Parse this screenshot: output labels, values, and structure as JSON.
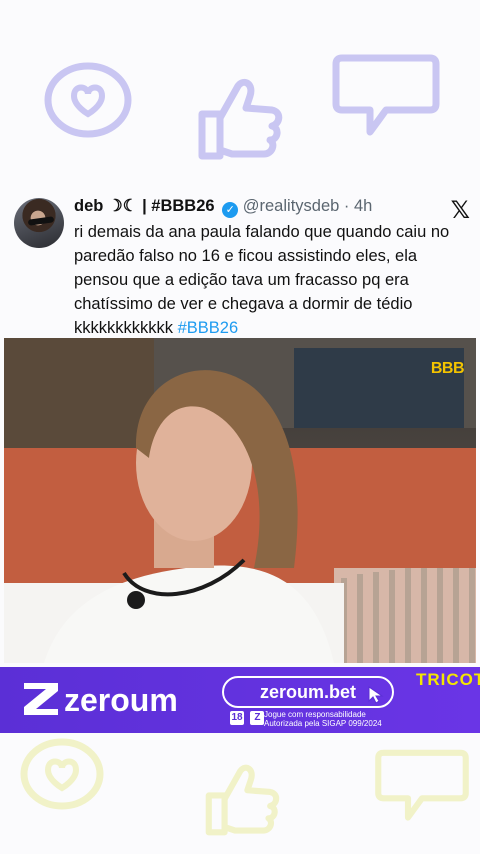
{
  "tweet": {
    "display_name": "deb ☽☾ | #BBB26",
    "verified_icon": "verified-badge-icon",
    "handle": "@realitysdeb",
    "time": "· 4h",
    "platform_icon": "x-logo-icon",
    "text_part1": "ri demais da ana paula falando que quando caiu no paredão falso no 16 e ficou assistindo eles, ela pensou que a edição tava um fracasso pq era chatíssimo de ver e chegava a dormir de tédio kkkkkkkkkkkk ",
    "hashtag": "#BBB26"
  },
  "media": {
    "badge": "BBB"
  },
  "ad": {
    "brand": "zeroum",
    "url": "zeroum.bet",
    "age_badge": "18",
    "note": "Jogue com responsabilidade Autorizada pela SIGAP 099/2024",
    "tricotei": "TRICOTEI"
  },
  "colors": {
    "background": "#fbfbfd",
    "doodle_top": "#c9c6f2",
    "doodle_bottom": "#f1f2c8",
    "ad_purple": "#5b2fd6",
    "link_blue": "#1d9bf0",
    "accent_yellow": "#f3e600"
  }
}
